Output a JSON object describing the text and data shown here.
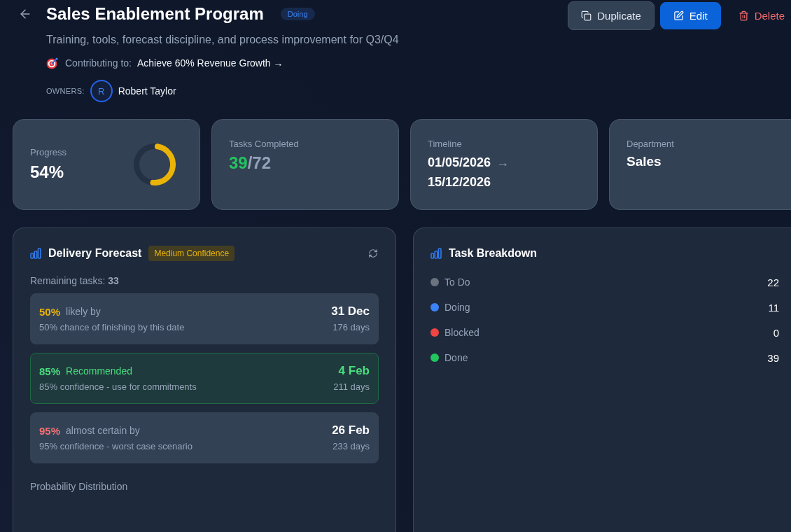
{
  "header": {
    "title": "Sales Enablement Program",
    "status": "Doing",
    "description": "Training, tools, forecast discipline, and process improvement for Q3/Q4",
    "contributing": {
      "label": "Contributing to:",
      "goal": "Achieve 60% Revenue Growth →"
    },
    "owners": {
      "label": "OWNERS:",
      "people": [
        {
          "initial": "R",
          "name": "Robert Taylor"
        }
      ]
    },
    "actions": [
      {
        "label": "Duplicate",
        "kind": "duplicate"
      },
      {
        "label": "Edit",
        "kind": "edit"
      },
      {
        "label": "Delete",
        "kind": "delete"
      }
    ]
  },
  "stats": [
    {
      "kind": "progress",
      "label": "Progress",
      "value": "54%",
      "level": 0.54
    },
    {
      "kind": "ratio",
      "label": "Tasks Completed",
      "completed": "39",
      "total": "/72"
    },
    {
      "kind": "range",
      "label": "Timeline",
      "start": "01/05/2026",
      "arrow": "→",
      "end": "15/12/2026"
    },
    {
      "kind": "text",
      "label": "Department",
      "value": "Sales"
    }
  ],
  "forecast": {
    "title": "Delivery Forecast",
    "confidence": "Medium Confidence",
    "remaining": "Remaining tasks: **33**",
    "scenarios": [
      {
        "percent": "50%",
        "label": "likely by",
        "note": "50% chance of finishing by this date",
        "date": "31 Dec",
        "days": "176 days",
        "color": "#eab308",
        "recommended": false
      },
      {
        "percent": "85%",
        "label": "Recommended",
        "note": "85% confidence - use for commitments",
        "date": "4 Feb",
        "days": "211 days",
        "color": "#4ade80",
        "recommended": true
      },
      {
        "percent": "95%",
        "label": "almost certain by",
        "note": "95% confidence - worst case scenario",
        "date": "26 Feb",
        "days": "233 days",
        "color": "#f87171",
        "recommended": false
      }
    ],
    "distribution_title": "Probability Distribution"
  },
  "breakdown": {
    "title": "Task Breakdown",
    "items": [
      {
        "label": "To Do",
        "count": "22",
        "color": "#6b7280"
      },
      {
        "label": "Doing",
        "count": "11",
        "color": "#3b82f6"
      },
      {
        "label": "Blocked",
        "count": "0",
        "color": "#ef4444"
      },
      {
        "label": "Done",
        "count": "39",
        "color": "#22c55e"
      }
    ]
  }
}
